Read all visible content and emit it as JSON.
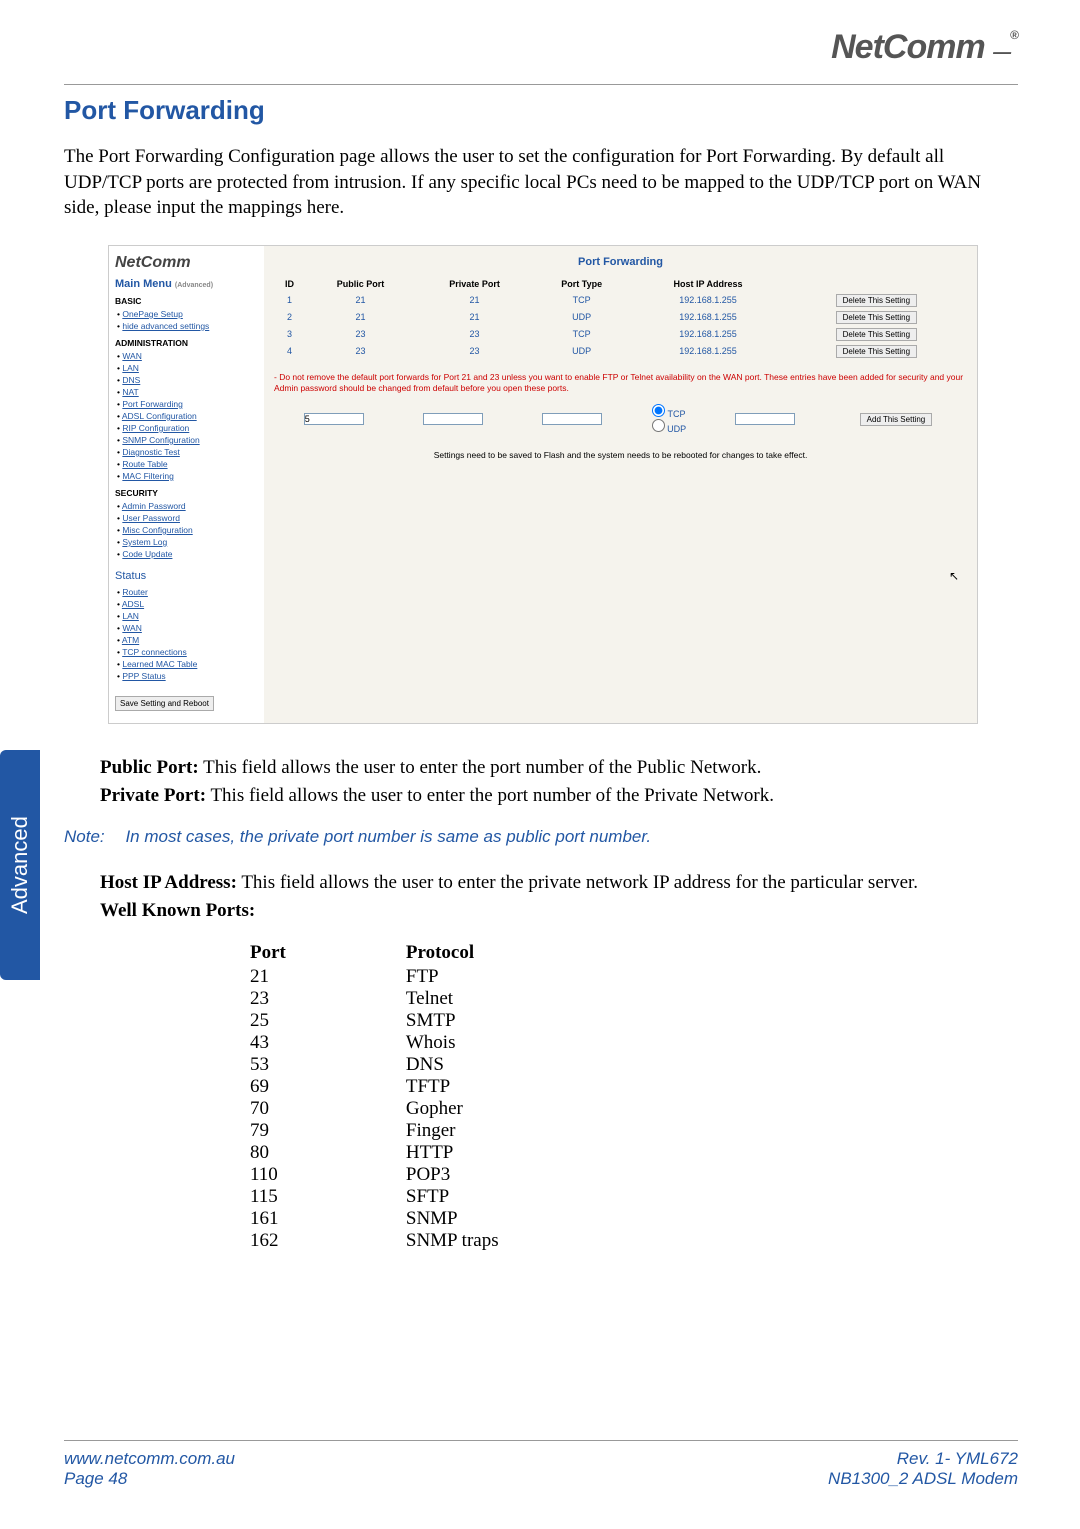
{
  "header": {
    "brand": "NetComm",
    "reg": "®"
  },
  "title": "Port Forwarding",
  "intro": "The Port Forwarding Configuration page allows the user to set the configuration for Port Forwarding. By default all UDP/TCP ports are protected from intrusion. If any specific local PCs need to be mapped to the UDP/TCP port on WAN side, please input the mappings here.",
  "screenshot": {
    "logo": "NetComm",
    "main_menu": "Main Menu",
    "main_menu_sub": "(Advanced)",
    "sections": {
      "basic": "BASIC",
      "basic_items": [
        "OnePage Setup",
        "hide advanced settings"
      ],
      "admin": "ADMINISTRATION",
      "admin_items": [
        "WAN",
        "LAN",
        "DNS",
        "NAT",
        "Port Forwarding",
        "ADSL Configuration",
        "RIP Configuration",
        "SNMP Configuration",
        "Diagnostic Test",
        "Route Table",
        "MAC Filtering"
      ],
      "security": "SECURITY",
      "security_items": [
        "Admin Password",
        "User Password",
        "Misc Configuration",
        "System Log",
        "Code Update"
      ],
      "status": "Status",
      "status_items": [
        "Router",
        "ADSL",
        "LAN",
        "WAN",
        "ATM",
        "TCP connections",
        "Learned MAC Table",
        "PPP Status"
      ]
    },
    "save_reboot": "Save Setting and Reboot",
    "pane_title": "Port Forwarding",
    "table": {
      "headers": [
        "ID",
        "Public Port",
        "Private Port",
        "Port Type",
        "Host IP Address",
        ""
      ],
      "rows": [
        {
          "id": "1",
          "pub": "21",
          "priv": "21",
          "type": "TCP",
          "ip": "192.168.1.255",
          "btn": "Delete This Setting"
        },
        {
          "id": "2",
          "pub": "21",
          "priv": "21",
          "type": "UDP",
          "ip": "192.168.1.255",
          "btn": "Delete This Setting"
        },
        {
          "id": "3",
          "pub": "23",
          "priv": "23",
          "type": "TCP",
          "ip": "192.168.1.255",
          "btn": "Delete This Setting"
        },
        {
          "id": "4",
          "pub": "23",
          "priv": "23",
          "type": "UDP",
          "ip": "192.168.1.255",
          "btn": "Delete This Setting"
        }
      ]
    },
    "warning": "- Do not remove the default port forwards for Port 21 and 23 unless you want to enable FTP or Telnet availability on the WAN port. These entries have been added for security and your Admin password should be changed from default before you open these ports.",
    "add_row": {
      "id": "5",
      "tcp": "TCP",
      "udp": "UDP",
      "btn": "Add This Setting"
    },
    "save_note": "Settings need to be saved to Flash and the system needs to be rebooted for changes to take effect."
  },
  "defs": {
    "pub_label": "Public Port:",
    "pub_text": "  This field allows the user to enter the port number of the Public Network.",
    "priv_label": "Private Port:",
    "priv_text": " This field allows the user to enter the port number of the Private Network."
  },
  "note": {
    "label": "Note:",
    "text": "In most cases, the private port number is same as public port number."
  },
  "host": {
    "label": "Host IP Address:",
    "text": "  This field allows the user to enter the private network IP address for the particular server."
  },
  "wellknown": {
    "label": "Well Known Ports:",
    "h1": "Port",
    "h2": "Protocol",
    "rows": [
      {
        "p": "21",
        "n": "FTP"
      },
      {
        "p": "23",
        "n": "Telnet"
      },
      {
        "p": "25",
        "n": "SMTP"
      },
      {
        "p": "43",
        "n": "Whois"
      },
      {
        "p": "53",
        "n": "DNS"
      },
      {
        "p": "69",
        "n": "TFTP"
      },
      {
        "p": "70",
        "n": "Gopher"
      },
      {
        "p": "79",
        "n": "Finger"
      },
      {
        "p": "80",
        "n": "HTTP"
      },
      {
        "p": "110",
        "n": "POP3"
      },
      {
        "p": "115",
        "n": "SFTP"
      },
      {
        "p": "161",
        "n": "SNMP"
      },
      {
        "p": "162",
        "n": "SNMP traps"
      }
    ]
  },
  "side_tab": "Advanced",
  "footer": {
    "url": "www.netcomm.com.au",
    "page": "Page 48",
    "rev": "Rev. 1- YML672",
    "model": "NB1300_2 ADSL Modem"
  }
}
